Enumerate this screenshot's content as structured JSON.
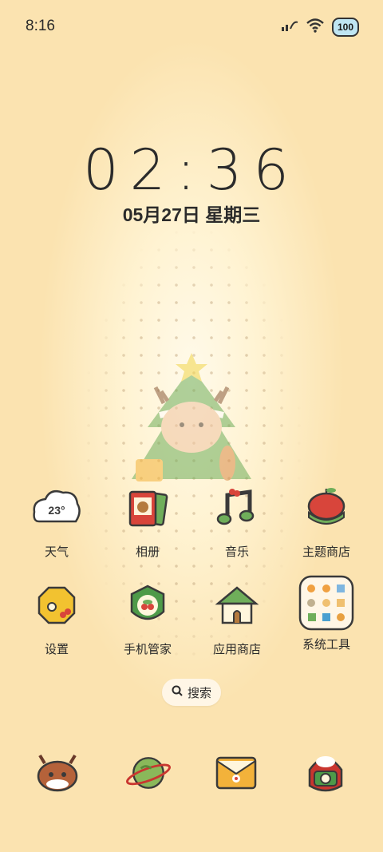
{
  "status_bar": {
    "time": "8:16",
    "signal_icon": "signal-icon",
    "wifi_icon": "wifi-icon",
    "battery_level": "100"
  },
  "lockscreen": {
    "clock": "02:36",
    "date": "05月27日 星期三"
  },
  "apps": [
    {
      "label": "天气",
      "icon": "weather-cloud-icon",
      "temp": "23°"
    },
    {
      "label": "相册",
      "icon": "photo-album-icon"
    },
    {
      "label": "音乐",
      "icon": "music-note-icon"
    },
    {
      "label": "主题商店",
      "icon": "theme-store-apple-icon"
    },
    {
      "label": "设置",
      "icon": "settings-gear-icon"
    },
    {
      "label": "手机管家",
      "icon": "phone-manager-shield-icon"
    },
    {
      "label": "应用商店",
      "icon": "app-store-house-icon"
    },
    {
      "label": "系统工具",
      "icon": "system-tools-folder-icon"
    }
  ],
  "search": {
    "label": "搜索"
  },
  "dock": [
    {
      "icon": "deer-phone-icon"
    },
    {
      "icon": "planet-browser-icon"
    },
    {
      "icon": "envelope-messages-icon"
    },
    {
      "icon": "camera-icon"
    }
  ],
  "colors": {
    "background": "#fbe3b0",
    "text": "#2b2b2b",
    "accent_red": "#c9362f",
    "accent_green": "#4e9a49"
  }
}
